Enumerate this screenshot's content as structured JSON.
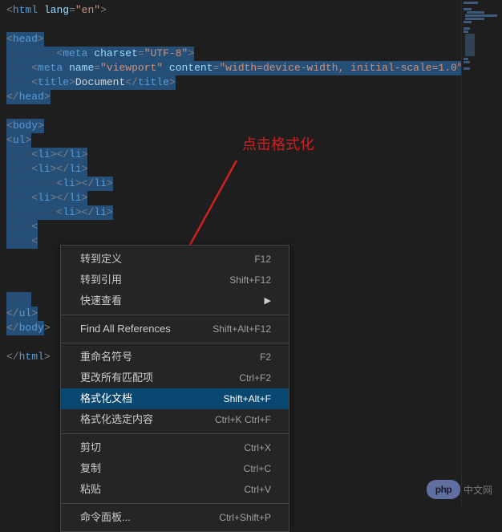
{
  "annotation": "点击格式化",
  "code": {
    "line1_open": "<",
    "line1_tag": "html",
    "line1_space": " ",
    "line1_attr": "lang",
    "line1_eq": "=",
    "line1_val": "\"en\"",
    "line1_close": ">",
    "line3_open": "<",
    "line3_tag": "head",
    "line3_close": ">",
    "line4_hidden": "········",
    "line4_open": "<",
    "line4_tag": "meta",
    "line4_space": " ",
    "line4_attr": "charset",
    "line4_eq": "=",
    "line4_val": "\"UTF-8\"",
    "line4_close": ">",
    "line5_hidden": "····",
    "line5_open": "<",
    "line5_tag": "meta",
    "line5_space": " ",
    "line5_attr1": "name",
    "line5_eq1": "=",
    "line5_val1": "\"viewport\"",
    "line5_space2": " ",
    "line5_attr2": "content",
    "line5_eq2": "=",
    "line5_val2": "\"width=device-width, initial-scale=1.0\"",
    "line6_hidden": "····",
    "line6_open": "<",
    "line6_tag": "title",
    "line6_close": ">",
    "line6_text": "Document",
    "line6_open2": "</",
    "line6_tag2": "title",
    "line6_close2": ">",
    "line7_open": "</",
    "line7_tag": "head",
    "line7_close": ">",
    "line9_open": "<",
    "line9_tag": "body",
    "line9_close": ">",
    "line10_open": "<",
    "line10_tag": "ul",
    "line10_close": ">",
    "li_hidden4": "····",
    "li_hidden8": "········",
    "li_open": "<",
    "li_tag": "li",
    "li_close": ">",
    "li_open2": "</",
    "li_close2": ">",
    "ul_open2": "</",
    "ul_tag": "ul",
    "ul_close2": ">",
    "body_open2": "</",
    "body_tag2": "body",
    "body_close2": ">",
    "html_open2": "</",
    "html_tag2": "html",
    "html_close2": ">"
  },
  "menu": {
    "goto_def": "转到定义",
    "goto_def_key": "F12",
    "goto_ref": "转到引用",
    "goto_ref_key": "Shift+F12",
    "peek": "快速查看",
    "find_refs": "Find All References",
    "find_refs_key": "Shift+Alt+F12",
    "rename": "重命名符号",
    "rename_key": "F2",
    "change_occ": "更改所有匹配项",
    "change_occ_key": "Ctrl+F2",
    "format_doc": "格式化文档",
    "format_doc_key": "Shift+Alt+F",
    "format_sel": "格式化选定内容",
    "format_sel_key": "Ctrl+K Ctrl+F",
    "cut": "剪切",
    "cut_key": "Ctrl+X",
    "copy": "复制",
    "copy_key": "Ctrl+C",
    "paste": "粘贴",
    "paste_key": "Ctrl+V",
    "cmd_palette": "命令面板...",
    "cmd_palette_key": "Ctrl+Shift+P"
  },
  "watermark": {
    "badge": "php",
    "text": "中文网"
  }
}
